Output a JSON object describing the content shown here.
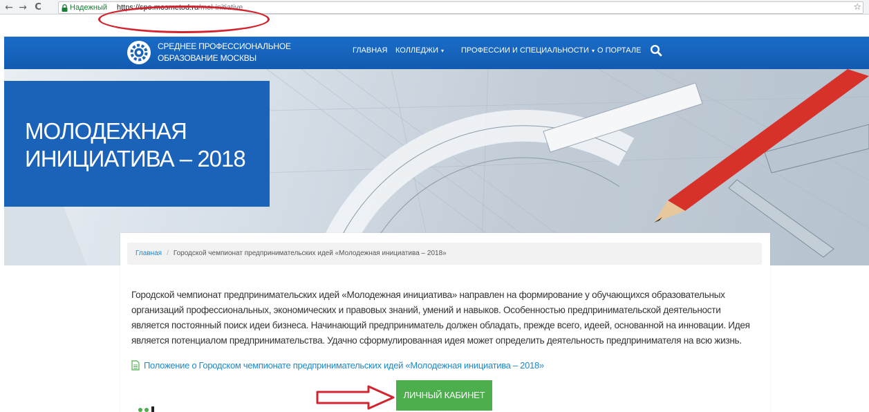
{
  "browser": {
    "back_icon": "back-arrow-icon",
    "back_glyph": "←",
    "forward_icon": "forward-arrow-icon",
    "forward_glyph": "→",
    "reload_icon": "reload-icon",
    "reload_glyph": "C",
    "secure_label": "Надежный",
    "url_scheme": "https://spo.mosmetod.ru",
    "url_path": "/mol-initiative",
    "bookmark_icon": "star-icon",
    "bookmark_glyph": "☆",
    "highlight_color": "#d1242f"
  },
  "site": {
    "logo_line1": "СРЕДНЕЕ ПРОФЕССИОНАЛЬНОЕ",
    "logo_line2": "ОБРАЗОВАНИЕ МОСКВЫ",
    "nav": {
      "home": "ГЛАВНАЯ",
      "colleges": "КОЛЛЕДЖИ",
      "professions": "ПРОФЕССИИ И СПЕЦИАЛЬНОСТИ",
      "about": "О ПОРТАЛЕ"
    },
    "caret": "▾",
    "brand_color": "#1565c0"
  },
  "hero": {
    "title_line1": "МОЛОДЕЖНАЯ",
    "title_line2": "ИНИЦИАТИВА – 2018"
  },
  "breadcrumb": {
    "home": "Главная",
    "separator": "/",
    "current": "Городской чемпионат предпринимательских идей «Молодежная инициатива – 2018»"
  },
  "content": {
    "intro": "Городской чемпионат предпринимательских идей «Молодежная инициатива» направлен на формирование у обучающихся образовательных организаций профессиональных, экономических и правовых знаний, умений и навыков. Особенностью предпринимательской деятельности является постоянный поиск идеи бизнеса. Начинающий предприниматель должен обладать, прежде всего, идеей, основанной на инновации. Идея является потенциалом предпринимательства. Удачно сформулированная идея может определить деятельность предпринимателя на всю жизнь.",
    "doc_link": "Положение о Городском чемпионате предпринимательских идей «Молодежная инициатива – 2018»",
    "cabinet_button": "ЛИЧНЫЙ КАБИНЕТ",
    "button_color": "#4cae4c"
  }
}
